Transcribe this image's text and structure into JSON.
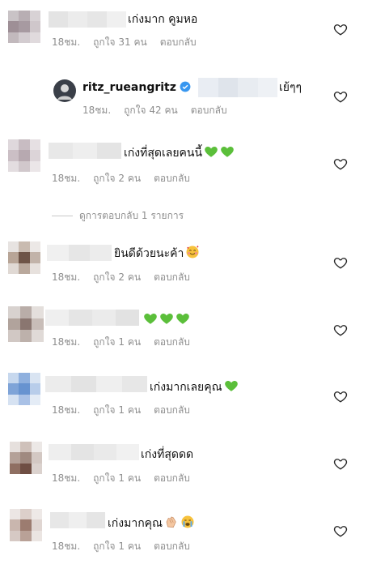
{
  "comments": [
    {
      "text": "เก่งมาก คูมหอ",
      "time": "18ชม.",
      "likes": "ถูกใจ 31 คน",
      "reply": "ตอบกลับ"
    },
    {
      "user": "ritz_rueangritz",
      "text": "เย้ๆๆ",
      "time": "18ชม.",
      "likes": "ถูกใจ 42 คน",
      "reply": "ตอบกลับ"
    },
    {
      "text": "เก่งที่สุดเลยคนนี้",
      "time": "18ชม.",
      "likes": "ถูกใจ 2 คน",
      "reply": "ตอบกลับ"
    },
    {
      "text": "ยินดีด้วยนะค้า",
      "time": "18ชม.",
      "likes": "ถูกใจ 2 คน",
      "reply": "ตอบกลับ"
    },
    {
      "text": "",
      "time": "18ชม.",
      "likes": "ถูกใจ 1 คน",
      "reply": "ตอบกลับ"
    },
    {
      "text": "เก่งมากเลยคุณ",
      "time": "18ชม.",
      "likes": "ถูกใจ 1 คน",
      "reply": "ตอบกลับ"
    },
    {
      "text": "เก่งที่สุดดด",
      "time": "18ชม.",
      "likes": "ถูกใจ 1 คน",
      "reply": "ตอบกลับ"
    },
    {
      "text": "เก่งมากคุณ",
      "time": "18ชม.",
      "likes": "ถูกใจ 1 คน",
      "reply": "ตอบกลับ"
    }
  ],
  "view_replies": "ดูการตอบกลับ 1 รายการ",
  "icons": {
    "like": "heart-outline-icon",
    "verified": "verified-badge-icon",
    "green_heart": "green-heart-emoji",
    "smiling_hearts": "smiling-face-with-hearts-emoji",
    "clap": "clapping-hands-emoji",
    "cry": "loudly-crying-emoji"
  },
  "colors": {
    "text": "#111111",
    "meta": "#8e8e8e",
    "verified": "#3897f0",
    "green_heart": "#5bbf3a"
  }
}
